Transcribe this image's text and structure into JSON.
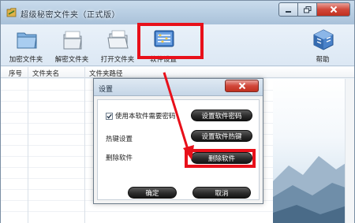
{
  "window": {
    "title": "超级秘密文件夹（正式版）",
    "controls": [
      "minimize",
      "maximize",
      "close"
    ]
  },
  "toolbar": {
    "items": [
      {
        "label": "加密文件夹",
        "icon": "lock-folder-icon"
      },
      {
        "label": "解密文件夹",
        "icon": "unlock-folder-icon"
      },
      {
        "label": "打开文件夹",
        "icon": "open-folder-icon"
      },
      {
        "label": "软件设置",
        "icon": "settings-panel-icon"
      },
      {
        "label": "帮助",
        "icon": "help-cube-icon"
      }
    ],
    "highlighted": "软件设置"
  },
  "table": {
    "columns": [
      "序号",
      "文件夹名",
      "文件夹路径"
    ],
    "rows": []
  },
  "dialog": {
    "title": "设置",
    "checkbox_label": "使用本软件需要密码",
    "checkbox_checked": true,
    "hotkey_label": "热键设置",
    "uninstall_label": "删除软件",
    "buttons": {
      "set_password": "设置软件密码",
      "set_hotkey": "设置软件热键",
      "uninstall": "删除软件",
      "ok": "确定",
      "cancel": "取消"
    },
    "highlighted": "删除软件"
  },
  "colors": {
    "highlight": "#e8101a",
    "button_dark": "#2c2c2c",
    "close_red": "#d1473a"
  }
}
